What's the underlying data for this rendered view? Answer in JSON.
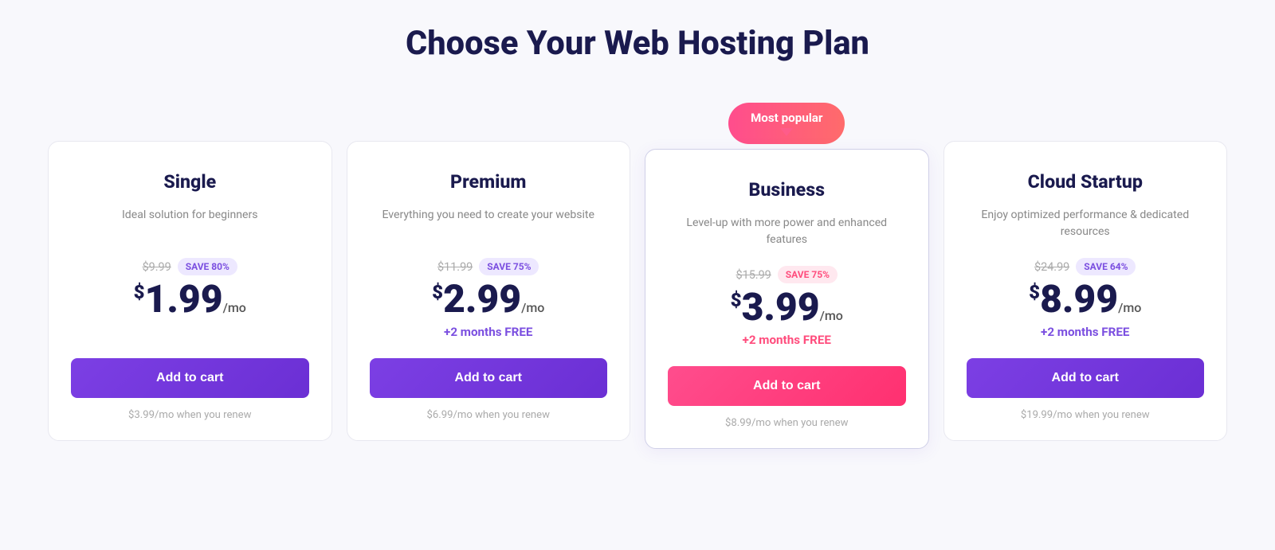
{
  "page": {
    "title": "Choose Your Web Hosting Plan"
  },
  "plans": [
    {
      "id": "single",
      "name": "Single",
      "desc": "Ideal solution for beginners",
      "original_price": "$9.99",
      "save_label": "SAVE 80%",
      "save_style": "purple",
      "price_dollar": "$",
      "price_main": "1.99",
      "price_period": "/mo",
      "free_months": "",
      "free_months_style": "",
      "cta_label": "Add to cart",
      "cta_style": "purple",
      "renew_text": "$3.99/mo when you renew",
      "popular": false
    },
    {
      "id": "premium",
      "name": "Premium",
      "desc": "Everything you need to create your website",
      "original_price": "$11.99",
      "save_label": "SAVE 75%",
      "save_style": "purple",
      "price_dollar": "$",
      "price_main": "2.99",
      "price_period": "/mo",
      "free_months": "+2 months FREE",
      "free_months_style": "purple",
      "cta_label": "Add to cart",
      "cta_style": "purple",
      "renew_text": "$6.99/mo when you renew",
      "popular": false
    },
    {
      "id": "business",
      "name": "Business",
      "desc": "Level-up with more power and enhanced features",
      "original_price": "$15.99",
      "save_label": "SAVE 75%",
      "save_style": "pink",
      "price_dollar": "$",
      "price_main": "3.99",
      "price_period": "/mo",
      "free_months": "+2 months FREE",
      "free_months_style": "pink",
      "cta_label": "Add to cart",
      "cta_style": "pink",
      "renew_text": "$8.99/mo when you renew",
      "popular": true,
      "popular_label": "Most popular"
    },
    {
      "id": "cloud-startup",
      "name": "Cloud Startup",
      "desc": "Enjoy optimized performance & dedicated resources",
      "original_price": "$24.99",
      "save_label": "SAVE 64%",
      "save_style": "purple",
      "price_dollar": "$",
      "price_main": "8.99",
      "price_period": "/mo",
      "free_months": "+2 months FREE",
      "free_months_style": "purple",
      "cta_label": "Add to cart",
      "cta_style": "purple",
      "renew_text": "$19.99/mo when you renew",
      "popular": false
    }
  ]
}
